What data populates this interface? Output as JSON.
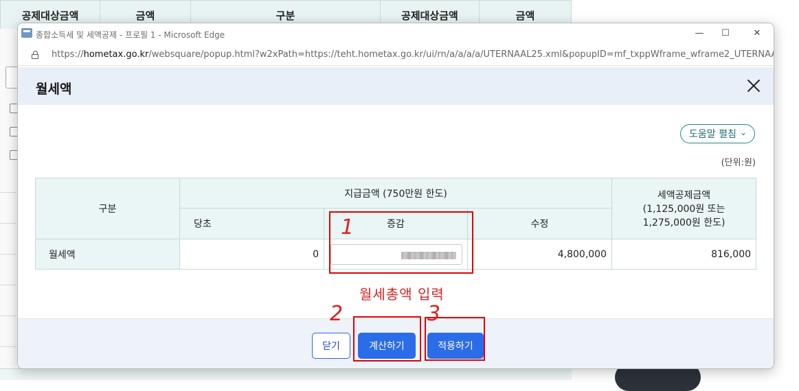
{
  "background": {
    "headers": [
      "공제대상금액",
      "금액",
      "구분",
      "공제대상금액",
      "금액"
    ]
  },
  "window": {
    "title": "종합소득세 및 세액공제 - 프로필 1 - Microsoft Edge",
    "controls": {
      "minimize": "—",
      "maximize": "☐",
      "close": "✕"
    },
    "url_prefix": "https://",
    "url_host": "hometax.go.kr",
    "url_path": "/websquare/popup.html?w2xPath=https://teht.hometax.go.kr/ui/rn/a/a/a/a/UTERNAAL25.xml&popupID=mf_txppWframe_wframe2_UTERNAAZ..."
  },
  "popup": {
    "title": "월세액",
    "help_button": "도움말 펼침",
    "unit": "(단위:원)",
    "table": {
      "col_category": "구분",
      "group_payment": "지급금액 (750만원 한도)",
      "col_initial": "당초",
      "col_change": "증감",
      "col_revised": "수정",
      "col_credit_line1": "세액공제금액",
      "col_credit_line2": "(1,125,000원 또는",
      "col_credit_line3": "1,275,000원 한도)",
      "row": {
        "label": "월세액",
        "initial": "0",
        "revised": "4,800,000",
        "credit": "816,000"
      }
    },
    "buttons": {
      "close": "닫기",
      "calculate": "계산하기",
      "apply": "적용하기"
    }
  },
  "annotations": {
    "instruction": "월세총액 입력",
    "step1": "1",
    "step2": "2",
    "step3": "3",
    "color": "#e02020"
  }
}
